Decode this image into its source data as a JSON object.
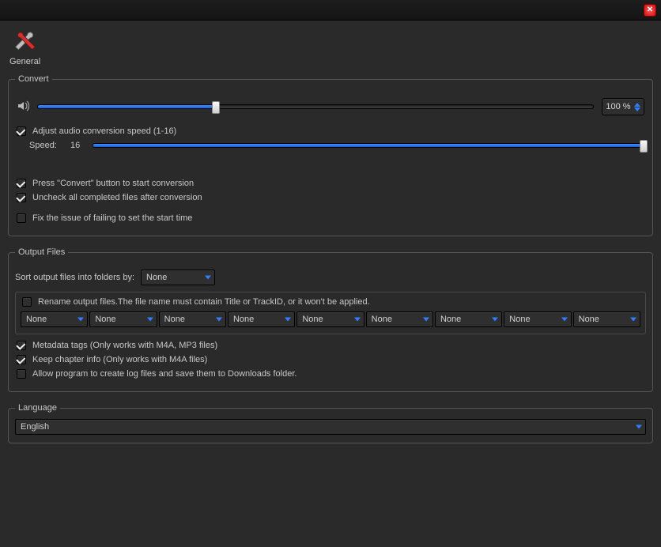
{
  "header": {
    "tab_label": "General"
  },
  "convert": {
    "legend": "Convert",
    "volume_percent_label": "100 %",
    "volume_fill_pct": 32,
    "adjust_speed_label": "Adjust audio conversion speed (1-16)",
    "adjust_speed_checked": true,
    "speed_label": "Speed:",
    "speed_value": "16",
    "speed_fill_pct": 100,
    "press_convert_label": "Press \"Convert\" button to start conversion",
    "press_convert_checked": true,
    "uncheck_completed_label": "Uncheck all completed files after conversion",
    "uncheck_completed_checked": true,
    "fix_start_time_label": "Fix the issue of failing to set the start time",
    "fix_start_time_checked": false
  },
  "output": {
    "legend": "Output Files",
    "sort_label": "Sort output files into folders by:",
    "sort_value": "None",
    "rename_label": "Rename output files.The file name must contain Title or TrackID, or it won't be applied.",
    "rename_checked": false,
    "rename_values": [
      "None",
      "None",
      "None",
      "None",
      "None",
      "None",
      "None",
      "None",
      "None"
    ],
    "metadata_label": "Metadata tags (Only works with M4A, MP3 files)",
    "metadata_checked": true,
    "chapter_label": "Keep chapter info (Only works with M4A files)",
    "chapter_checked": true,
    "logfiles_label": "Allow program to create log files and save them to Downloads folder.",
    "logfiles_checked": false
  },
  "language": {
    "legend": "Language",
    "value": "English"
  }
}
